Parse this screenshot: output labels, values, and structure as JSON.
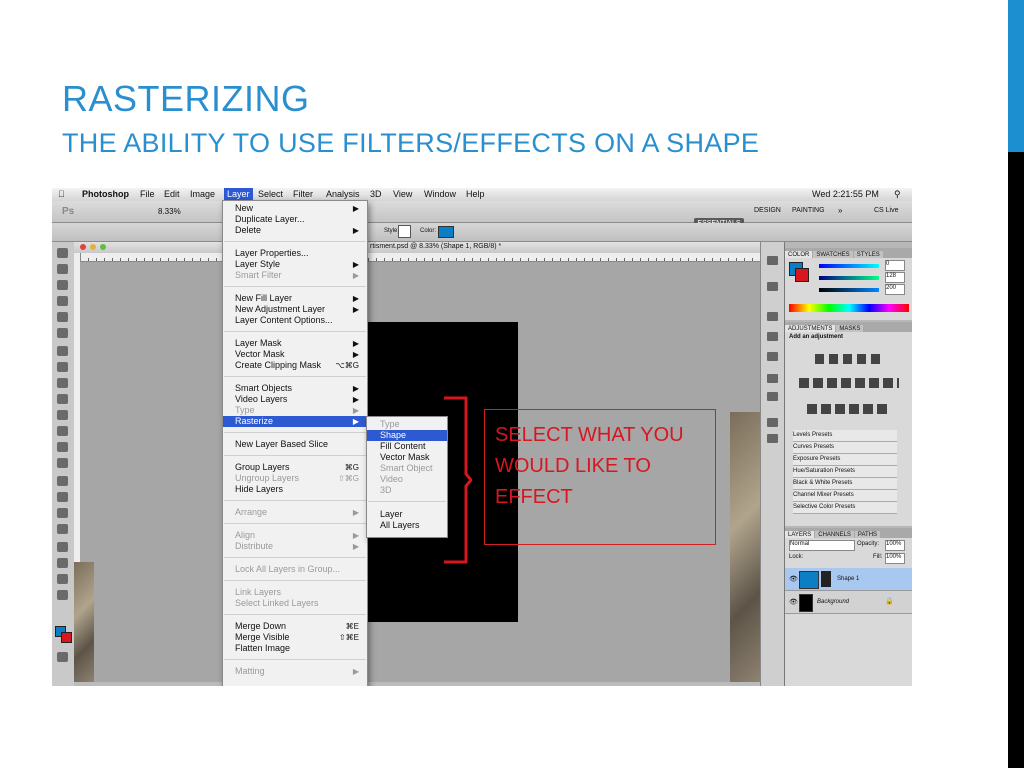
{
  "slide": {
    "title": "RASTERIZING",
    "subtitle": "THE ABILITY TO USE FILTERS/EFFECTS ON A SHAPE",
    "accent_color": "#1c8fd0"
  },
  "menubar": {
    "items": [
      "Photoshop",
      "File",
      "Edit",
      "Image",
      "Layer",
      "Select",
      "Filter",
      "Analysis",
      "3D",
      "View",
      "Window",
      "Help"
    ],
    "clock": "Wed 2:21:55 PM"
  },
  "options_bar": {
    "zoom": "8.33%",
    "workspaces": [
      "ESSENTIALS",
      "DESIGN",
      "PAINTING"
    ],
    "more": "»",
    "cs_live": "CS Live",
    "style_label": "Style:",
    "color_label": "Color:"
  },
  "document": {
    "tab_title": "rtisment.psd @ 8.33% (Shape 1, RGB/8) *",
    "ruler_marks": [
      "30",
      "25",
      "20",
      "15",
      "10",
      "5",
      "0",
      "5",
      "10",
      "15",
      "20",
      "25",
      "30",
      "35",
      "40",
      "45",
      "50",
      "55"
    ]
  },
  "layer_menu": {
    "items": [
      {
        "label": "New",
        "shortcut": "",
        "submenu": true,
        "disabled": false
      },
      {
        "label": "Duplicate Layer...",
        "shortcut": "",
        "submenu": false,
        "disabled": false
      },
      {
        "label": "Delete",
        "shortcut": "",
        "submenu": true,
        "disabled": false
      },
      {
        "label": "Layer Properties...",
        "shortcut": "",
        "submenu": false,
        "disabled": false
      },
      {
        "label": "Layer Style",
        "shortcut": "",
        "submenu": true,
        "disabled": false
      },
      {
        "label": "Smart Filter",
        "shortcut": "",
        "submenu": true,
        "disabled": true
      },
      {
        "label": "New Fill Layer",
        "shortcut": "",
        "submenu": true,
        "disabled": false
      },
      {
        "label": "New Adjustment Layer",
        "shortcut": "",
        "submenu": true,
        "disabled": false
      },
      {
        "label": "Layer Content Options...",
        "shortcut": "",
        "submenu": false,
        "disabled": false
      },
      {
        "label": "Layer Mask",
        "shortcut": "",
        "submenu": true,
        "disabled": false
      },
      {
        "label": "Vector Mask",
        "shortcut": "",
        "submenu": true,
        "disabled": false
      },
      {
        "label": "Create Clipping Mask",
        "shortcut": "⌥⌘G",
        "submenu": false,
        "disabled": false
      },
      {
        "label": "Smart Objects",
        "shortcut": "",
        "submenu": true,
        "disabled": false
      },
      {
        "label": "Video Layers",
        "shortcut": "",
        "submenu": true,
        "disabled": false
      },
      {
        "label": "Type",
        "shortcut": "",
        "submenu": true,
        "disabled": true
      },
      {
        "label": "Rasterize",
        "shortcut": "",
        "submenu": true,
        "disabled": false,
        "highlighted": true
      },
      {
        "label": "New Layer Based Slice",
        "shortcut": "",
        "submenu": false,
        "disabled": false
      },
      {
        "label": "Group Layers",
        "shortcut": "⌘G",
        "submenu": false,
        "disabled": false
      },
      {
        "label": "Ungroup Layers",
        "shortcut": "⇧⌘G",
        "submenu": false,
        "disabled": true
      },
      {
        "label": "Hide Layers",
        "shortcut": "",
        "submenu": false,
        "disabled": false
      },
      {
        "label": "Arrange",
        "shortcut": "",
        "submenu": true,
        "disabled": true
      },
      {
        "label": "Align",
        "shortcut": "",
        "submenu": true,
        "disabled": true
      },
      {
        "label": "Distribute",
        "shortcut": "",
        "submenu": true,
        "disabled": true
      },
      {
        "label": "Lock All Layers in Group...",
        "shortcut": "",
        "submenu": false,
        "disabled": true
      },
      {
        "label": "Link Layers",
        "shortcut": "",
        "submenu": false,
        "disabled": true
      },
      {
        "label": "Select Linked Layers",
        "shortcut": "",
        "submenu": false,
        "disabled": true
      },
      {
        "label": "Merge Down",
        "shortcut": "⌘E",
        "submenu": false,
        "disabled": false
      },
      {
        "label": "Merge Visible",
        "shortcut": "⇧⌘E",
        "submenu": false,
        "disabled": false
      },
      {
        "label": "Flatten Image",
        "shortcut": "",
        "submenu": false,
        "disabled": false
      },
      {
        "label": "Matting",
        "shortcut": "",
        "submenu": true,
        "disabled": true
      }
    ]
  },
  "rasterize_submenu": {
    "items": [
      {
        "label": "Type",
        "disabled": true
      },
      {
        "label": "Shape",
        "disabled": false,
        "highlighted": true
      },
      {
        "label": "Fill Content",
        "disabled": false
      },
      {
        "label": "Vector Mask",
        "disabled": false
      },
      {
        "label": "Smart Object",
        "disabled": true
      },
      {
        "label": "Video",
        "disabled": true
      },
      {
        "label": "3D",
        "disabled": true
      },
      {
        "label": "Layer",
        "disabled": false
      },
      {
        "label": "All Layers",
        "disabled": false
      }
    ]
  },
  "callout": {
    "text": "SELECT WHAT YOU WOULD LIKE TO EFFECT",
    "color": "#d8161f"
  },
  "panels": {
    "color_tabs": [
      "COLOR",
      "SWATCHES",
      "STYLES"
    ],
    "color_values": [
      "0",
      "128",
      "200"
    ],
    "adjust_tabs": [
      "ADJUSTMENTS",
      "MASKS"
    ],
    "adjust_heading": "Add an adjustment",
    "presets": [
      "Levels Presets",
      "Curves Presets",
      "Exposure Presets",
      "Hue/Saturation Presets",
      "Black & White Presets",
      "Channel Mixer Presets",
      "Selective Color Presets"
    ],
    "layer_tabs": [
      "LAYERS",
      "CHANNELS",
      "PATHS"
    ],
    "blend_mode": "Normal",
    "opacity_label": "Opacity:",
    "opacity": "100%",
    "lock_label": "Lock:",
    "fill_label": "Fill:",
    "fill": "100%",
    "layers": [
      "Shape 1",
      "Background"
    ]
  }
}
